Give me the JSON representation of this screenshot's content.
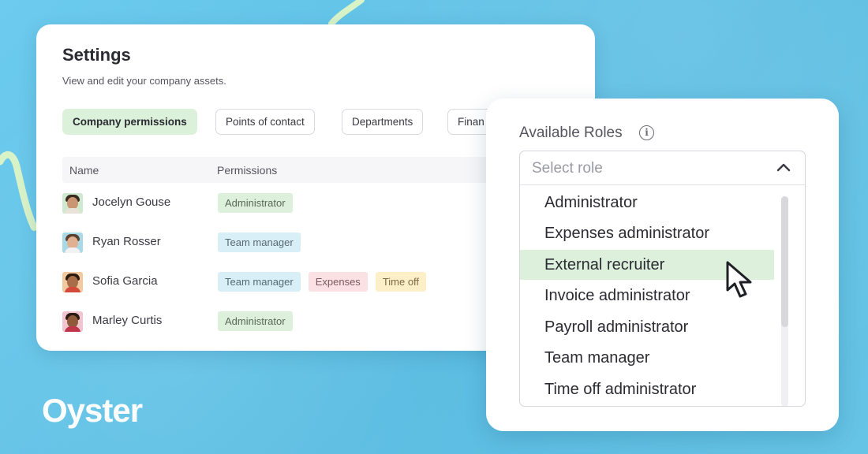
{
  "settings": {
    "title": "Settings",
    "subtitle": "View and edit your company assets.",
    "tabs": [
      {
        "label": "Company permissions",
        "active": true
      },
      {
        "label": "Points of contact",
        "active": false
      },
      {
        "label": "Departments",
        "active": false
      },
      {
        "label": "Finan",
        "active": false
      }
    ],
    "table": {
      "headers": [
        "Name",
        "Permissions"
      ],
      "rows": [
        {
          "name": "Jocelyn Gouse",
          "permissions": [
            "Administrator"
          ]
        },
        {
          "name": "Ryan Rosser",
          "permissions": [
            "Team manager"
          ]
        },
        {
          "name": "Sofia Garcia",
          "permissions": [
            "Team manager",
            "Expenses",
            "Time off"
          ]
        },
        {
          "name": "Marley Curtis",
          "permissions": [
            "Administrator"
          ]
        }
      ]
    }
  },
  "roles": {
    "label": "Available Roles",
    "info_icon": "info-icon",
    "placeholder": "Select role",
    "options": [
      "Administrator",
      "Expenses administrator",
      "External recruiter",
      "Invoice administrator",
      "Payroll administrator",
      "Team manager",
      "Time off administrator"
    ],
    "highlighted": "External recruiter"
  },
  "brand": {
    "logo_text": "Oyster",
    "background_color": "#62c2e5",
    "accent_green": "#dcf0db"
  }
}
